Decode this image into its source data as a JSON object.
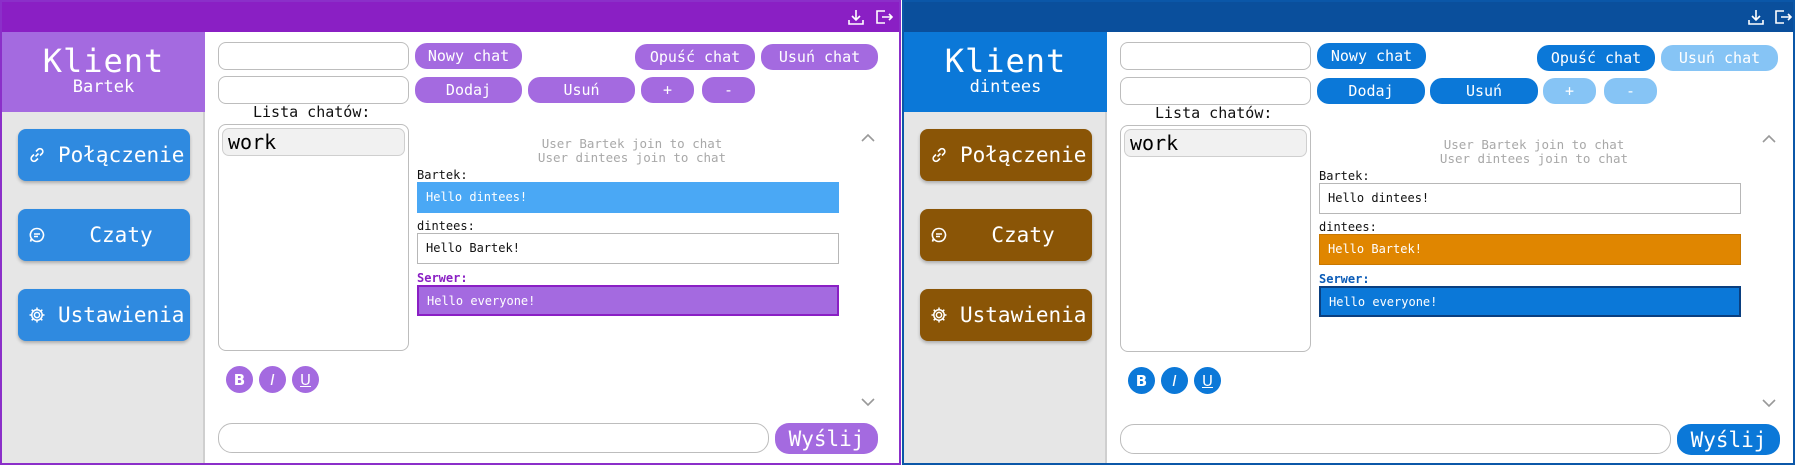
{
  "windows": [
    {
      "brand": {
        "title": "Klient",
        "user": "Bartek"
      },
      "nav": [
        {
          "label": "Połączenie",
          "icon": "link-icon"
        },
        {
          "label": "Czaty",
          "icon": "chat-icon"
        },
        {
          "label": "Ustawienia",
          "icon": "gear-icon"
        }
      ],
      "toolbar": {
        "new_chat": "Nowy chat",
        "leave_chat": "Opuść chat",
        "delete_chat": "Usuń chat",
        "add": "Dodaj",
        "remove": "Usuń",
        "plus": "+",
        "minus": "-"
      },
      "chat_list": {
        "label": "Lista chatów:",
        "items": [
          "work"
        ]
      },
      "messages": {
        "system": [
          "User Bartek join to chat",
          "User dintees join to chat"
        ],
        "items": [
          {
            "sender": "Bartek:",
            "text": "Hello dintees!"
          },
          {
            "sender": "dintees:",
            "text": "Hello Bartek!"
          },
          {
            "sender": "Serwer:",
            "text": "Hello everyone!"
          }
        ]
      },
      "format": {
        "bold": "B",
        "italic": "I",
        "underline": "U"
      },
      "composer": {
        "send": "Wyślij"
      },
      "colors": {
        "accent": "#a46ae0",
        "title_bar": "#8a1fc4",
        "own_message": "#4aa8f5",
        "server_sender": "#8a1fc4",
        "nav_button": "#2f8ae0"
      }
    },
    {
      "brand": {
        "title": "Klient",
        "user": "dintees"
      },
      "nav": [
        {
          "label": "Połączenie",
          "icon": "link-icon"
        },
        {
          "label": "Czaty",
          "icon": "chat-icon"
        },
        {
          "label": "Ustawienia",
          "icon": "gear-icon"
        }
      ],
      "toolbar": {
        "new_chat": "Nowy chat",
        "leave_chat": "Opuść chat",
        "delete_chat": "Usuń chat",
        "add": "Dodaj",
        "remove": "Usuń",
        "plus": "+",
        "minus": "-"
      },
      "chat_list": {
        "label": "Lista chatów:",
        "items": [
          "work"
        ]
      },
      "messages": {
        "system": [
          "User Bartek join to chat",
          "User dintees join to chat"
        ],
        "items": [
          {
            "sender": "Bartek:",
            "text": "Hello dintees!"
          },
          {
            "sender": "dintees:",
            "text": "Hello Bartek!"
          },
          {
            "sender": "Serwer:",
            "text": "Hello everyone!"
          }
        ]
      },
      "format": {
        "bold": "B",
        "italic": "I",
        "underline": "U"
      },
      "composer": {
        "send": "Wyślij"
      },
      "colors": {
        "accent": "#0b78d8",
        "title_bar": "#0a4f9c",
        "own_message": "#e08600",
        "server_sender": "#0b5cb8",
        "nav_button": "#8a5506"
      }
    }
  ]
}
